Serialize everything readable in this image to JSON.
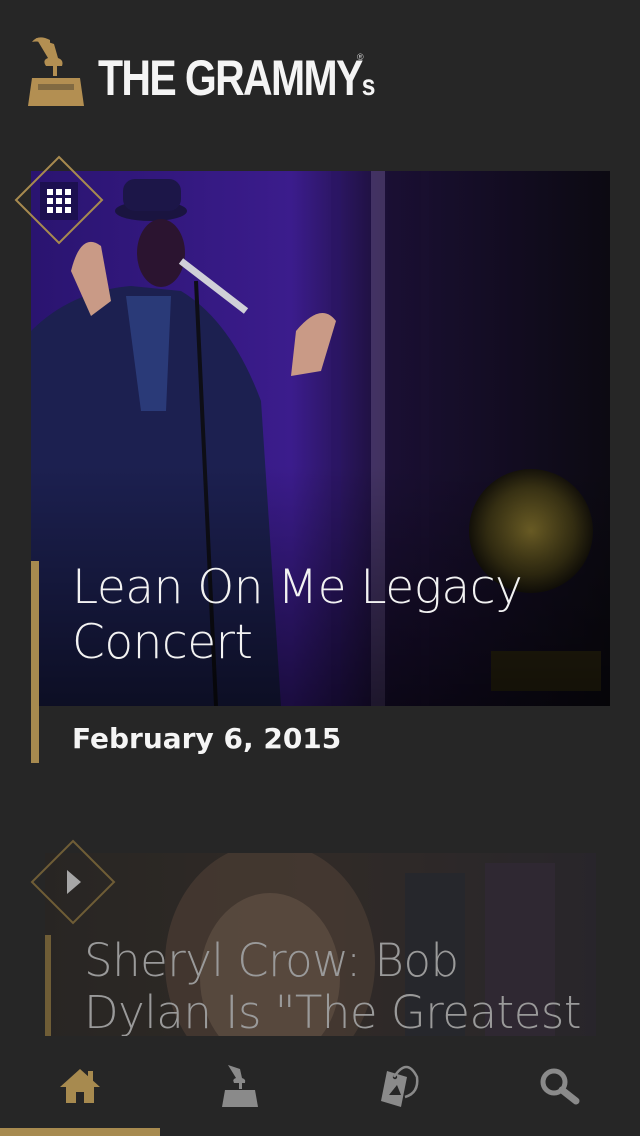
{
  "header": {
    "logo_text": "THE GRAMMY",
    "logo_suffix": "s",
    "logo_registered": "®"
  },
  "feed": [
    {
      "type": "gallery",
      "badge_icon": "grid-icon",
      "title": "Lean On Me Legacy Concert",
      "date": "February 6, 2015"
    },
    {
      "type": "video",
      "badge_icon": "play-icon",
      "title": "Sheryl Crow: Bob Dylan Is \"The Greatest"
    }
  ],
  "tabbar": {
    "tabs": [
      {
        "name": "home",
        "icon": "home-icon",
        "active": true
      },
      {
        "name": "awards",
        "icon": "gramophone-icon",
        "active": false
      },
      {
        "name": "tickets",
        "icon": "ticket-icon",
        "active": false
      },
      {
        "name": "search",
        "icon": "search-icon",
        "active": false
      }
    ]
  },
  "colors": {
    "background": "#262626",
    "accent_gold": "#a78a4f",
    "tab_icon_inactive": "#8a8a8a",
    "stage_purple": "#3a1a8a"
  }
}
